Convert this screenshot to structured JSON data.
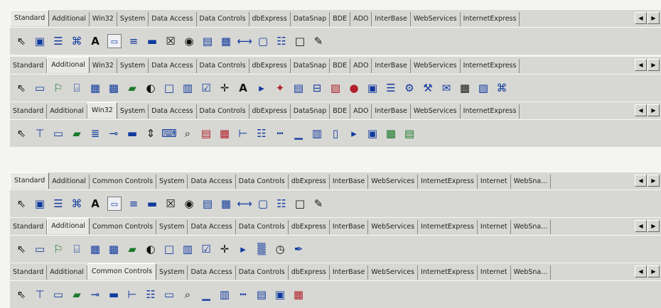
{
  "delphi_palettes": [
    {
      "tabs": [
        "Standard",
        "Additional",
        "Win32",
        "System",
        "Data Access",
        "Data Controls",
        "dbExpress",
        "DataSnap",
        "BDE",
        "ADO",
        "InterBase",
        "WebServices",
        "InternetExpress"
      ],
      "active": 0,
      "icons": [
        {
          "name": "pointer-icon",
          "glyph": "⇖",
          "cls": "dark"
        },
        {
          "name": "frame-icon",
          "glyph": "▣",
          "cls": ""
        },
        {
          "name": "mainmenu-icon",
          "glyph": "☰",
          "cls": ""
        },
        {
          "name": "popupmenu-icon",
          "glyph": "⌘",
          "cls": ""
        },
        {
          "name": "label-icon",
          "glyph": "A",
          "cls": "big"
        },
        {
          "name": "edit-icon",
          "glyph": "▭",
          "cls": "box"
        },
        {
          "name": "memo-icon",
          "glyph": "≡",
          "cls": ""
        },
        {
          "name": "button-icon",
          "glyph": "▬",
          "cls": ""
        },
        {
          "name": "checkbox-icon",
          "glyph": "☒",
          "cls": "dark"
        },
        {
          "name": "radiobutton-icon",
          "glyph": "◉",
          "cls": "dark"
        },
        {
          "name": "listbox-icon",
          "glyph": "▤",
          "cls": ""
        },
        {
          "name": "combobox-icon",
          "glyph": "▦",
          "cls": ""
        },
        {
          "name": "scrollbar-icon",
          "glyph": "⟷",
          "cls": ""
        },
        {
          "name": "groupbox-icon",
          "glyph": "▢",
          "cls": ""
        },
        {
          "name": "radiogroup-icon",
          "glyph": "☷",
          "cls": ""
        },
        {
          "name": "panel-icon",
          "glyph": "□",
          "cls": "dark"
        },
        {
          "name": "actionlist-icon",
          "glyph": "✎",
          "cls": "dark"
        }
      ]
    },
    {
      "tabs": [
        "Standard",
        "Additional",
        "Win32",
        "System",
        "Data Access",
        "Data Controls",
        "dbExpress",
        "DataSnap",
        "BDE",
        "ADO",
        "InterBase",
        "WebServices",
        "InternetExpress"
      ],
      "active": 1,
      "icons": [
        {
          "name": "pointer-icon",
          "glyph": "⇖",
          "cls": "dark"
        },
        {
          "name": "bitbtn-icon",
          "glyph": "▭",
          "cls": ""
        },
        {
          "name": "speedbutton-icon",
          "glyph": "⚐",
          "cls": "green"
        },
        {
          "name": "maskedit-icon",
          "glyph": "⌸",
          "cls": ""
        },
        {
          "name": "stringgrid-icon",
          "glyph": "▦",
          "cls": ""
        },
        {
          "name": "drawgrid-icon",
          "glyph": "▩",
          "cls": ""
        },
        {
          "name": "image-icon",
          "glyph": "▰",
          "cls": "green"
        },
        {
          "name": "shape-icon",
          "glyph": "◐",
          "cls": "dark"
        },
        {
          "name": "bevel-icon",
          "glyph": "□",
          "cls": ""
        },
        {
          "name": "scrollbox-icon",
          "glyph": "▥",
          "cls": ""
        },
        {
          "name": "checklistbox-icon",
          "glyph": "☑",
          "cls": ""
        },
        {
          "name": "splitter-icon",
          "glyph": "✛",
          "cls": "dark"
        },
        {
          "name": "statictext-icon",
          "glyph": "A",
          "cls": "big"
        },
        {
          "name": "controlbar-icon",
          "glyph": "▸",
          "cls": ""
        },
        {
          "name": "applicationevents-icon",
          "glyph": "✦",
          "cls": "red"
        },
        {
          "name": "valuelisteditor-icon",
          "glyph": "▤",
          "cls": ""
        },
        {
          "name": "labelededit-icon",
          "glyph": "⊟",
          "cls": ""
        },
        {
          "name": "colorbox-icon",
          "glyph": "▨",
          "cls": "red"
        },
        {
          "name": "chart-icon",
          "glyph": "●",
          "cls": "red"
        },
        {
          "name": "actionmanager-icon",
          "glyph": "▣",
          "cls": ""
        },
        {
          "name": "actionmainmenubar-icon",
          "glyph": "☰",
          "cls": ""
        },
        {
          "name": "actiontoolbar-icon",
          "glyph": "⚙",
          "cls": ""
        },
        {
          "name": "customizedlg-icon",
          "glyph": "⚒",
          "cls": ""
        },
        {
          "name": "xpmanifest-icon",
          "glyph": "✉",
          "cls": ""
        },
        {
          "name": "actionlist2-icon",
          "glyph": "▦",
          "cls": "dark"
        },
        {
          "name": "popupactionbar-icon",
          "glyph": "▧",
          "cls": ""
        },
        {
          "name": "colorlistbox-icon",
          "glyph": "⌘",
          "cls": ""
        }
      ]
    },
    {
      "tabs": [
        "Standard",
        "Additional",
        "Win32",
        "System",
        "Data Access",
        "Data Controls",
        "dbExpress",
        "DataSnap",
        "BDE",
        "ADO",
        "InterBase",
        "WebServices",
        "InternetExpress"
      ],
      "active": 2,
      "icons": [
        {
          "name": "pointer-icon",
          "glyph": "⇖",
          "cls": "dark"
        },
        {
          "name": "tabcontrol-icon",
          "glyph": "⊤",
          "cls": ""
        },
        {
          "name": "pagecontrol-icon",
          "glyph": "▭",
          "cls": ""
        },
        {
          "name": "imagelist-icon",
          "glyph": "▰",
          "cls": "green"
        },
        {
          "name": "richedit-icon",
          "glyph": "≣",
          "cls": ""
        },
        {
          "name": "trackbar-icon",
          "glyph": "⊸",
          "cls": ""
        },
        {
          "name": "progressbar-icon",
          "glyph": "▬",
          "cls": ""
        },
        {
          "name": "updown-icon",
          "glyph": "⇕",
          "cls": "dark"
        },
        {
          "name": "hotkey-icon",
          "glyph": "⌨",
          "cls": ""
        },
        {
          "name": "animate-icon",
          "glyph": "⌕",
          "cls": "dark"
        },
        {
          "name": "datetimepicker-icon",
          "glyph": "▤",
          "cls": "red"
        },
        {
          "name": "monthcalendar-icon",
          "glyph": "▦",
          "cls": "red"
        },
        {
          "name": "treeview-icon",
          "glyph": "⊢",
          "cls": ""
        },
        {
          "name": "listview-icon",
          "glyph": "☷",
          "cls": ""
        },
        {
          "name": "headercontrol-icon",
          "glyph": "┅",
          "cls": ""
        },
        {
          "name": "statusbar-icon",
          "glyph": "▁",
          "cls": ""
        },
        {
          "name": "toolbar-icon",
          "glyph": "▥",
          "cls": ""
        },
        {
          "name": "coolbar-icon",
          "glyph": "▯",
          "cls": ""
        },
        {
          "name": "pagescroller-icon",
          "glyph": "▸",
          "cls": ""
        },
        {
          "name": "comboboxex-icon",
          "glyph": "▣",
          "cls": ""
        },
        {
          "name": "flatscrollbar-icon",
          "glyph": "▩",
          "cls": "green"
        },
        {
          "name": "xp-icon",
          "glyph": "▤",
          "cls": "green"
        }
      ]
    },
    {
      "tabs": [
        "Standard",
        "Additional",
        "Common Controls",
        "System",
        "Data Access",
        "Data Controls",
        "dbExpress",
        "InterBase",
        "WebServices",
        "InternetExpress",
        "Internet",
        "WebSna..."
      ],
      "active": 0,
      "icons": [
        {
          "name": "pointer-icon",
          "glyph": "⇖",
          "cls": "dark"
        },
        {
          "name": "frame-icon",
          "glyph": "▣",
          "cls": ""
        },
        {
          "name": "mainmenu-icon",
          "glyph": "☰",
          "cls": ""
        },
        {
          "name": "popupmenu-icon",
          "glyph": "⌘",
          "cls": ""
        },
        {
          "name": "label-icon",
          "glyph": "A",
          "cls": "big"
        },
        {
          "name": "edit-icon",
          "glyph": "▭",
          "cls": "box"
        },
        {
          "name": "memo-icon",
          "glyph": "≡",
          "cls": ""
        },
        {
          "name": "button-icon",
          "glyph": "▬",
          "cls": ""
        },
        {
          "name": "checkbox-icon",
          "glyph": "☒",
          "cls": "dark"
        },
        {
          "name": "radiobutton-icon",
          "glyph": "◉",
          "cls": "dark"
        },
        {
          "name": "listbox-icon",
          "glyph": "▤",
          "cls": ""
        },
        {
          "name": "combobox-icon",
          "glyph": "▦",
          "cls": ""
        },
        {
          "name": "scrollbar-icon",
          "glyph": "⟷",
          "cls": ""
        },
        {
          "name": "groupbox-icon",
          "glyph": "▢",
          "cls": ""
        },
        {
          "name": "radiogroup-icon",
          "glyph": "☷",
          "cls": ""
        },
        {
          "name": "panel-icon",
          "glyph": "□",
          "cls": "dark"
        },
        {
          "name": "actionlist-icon",
          "glyph": "✎",
          "cls": "dark"
        }
      ]
    },
    {
      "tabs": [
        "Standard",
        "Additional",
        "Common Controls",
        "System",
        "Data Access",
        "Data Controls",
        "dbExpress",
        "InterBase",
        "WebServices",
        "InternetExpress",
        "Internet",
        "WebSna..."
      ],
      "active": 1,
      "icons": [
        {
          "name": "pointer-icon",
          "glyph": "⇖",
          "cls": "dark"
        },
        {
          "name": "bitbtn-icon",
          "glyph": "▭",
          "cls": ""
        },
        {
          "name": "speedbutton-icon",
          "glyph": "⚐",
          "cls": "green"
        },
        {
          "name": "maskedit-icon",
          "glyph": "⌸",
          "cls": ""
        },
        {
          "name": "stringgrid-icon",
          "glyph": "▦",
          "cls": ""
        },
        {
          "name": "drawgrid-icon",
          "glyph": "▩",
          "cls": ""
        },
        {
          "name": "image-icon",
          "glyph": "▰",
          "cls": "green"
        },
        {
          "name": "shape-icon",
          "glyph": "◐",
          "cls": "dark"
        },
        {
          "name": "bevel-icon",
          "glyph": "□",
          "cls": ""
        },
        {
          "name": "scrollbox-icon",
          "glyph": "▥",
          "cls": ""
        },
        {
          "name": "checklistbox-icon",
          "glyph": "☑",
          "cls": ""
        },
        {
          "name": "splitter-icon",
          "glyph": "✛",
          "cls": "dark"
        },
        {
          "name": "controlbar-icon",
          "glyph": "▸",
          "cls": ""
        },
        {
          "name": "lcdnumber-icon",
          "glyph": "▒",
          "cls": ""
        },
        {
          "name": "timer-icon",
          "glyph": "◷",
          "cls": "dark"
        },
        {
          "name": "pen-icon",
          "glyph": "✒",
          "cls": ""
        }
      ]
    },
    {
      "tabs": [
        "Standard",
        "Additional",
        "Common Controls",
        "System",
        "Data Access",
        "Data Controls",
        "dbExpress",
        "InterBase",
        "WebServices",
        "InternetExpress",
        "Internet",
        "WebSna..."
      ],
      "active": 2,
      "icons": [
        {
          "name": "pointer-icon",
          "glyph": "⇖",
          "cls": "dark"
        },
        {
          "name": "tabcontrol-icon",
          "glyph": "⊤",
          "cls": ""
        },
        {
          "name": "pagecontrol-icon",
          "glyph": "▭",
          "cls": ""
        },
        {
          "name": "imagelist-icon",
          "glyph": "▰",
          "cls": "green"
        },
        {
          "name": "trackbar-icon",
          "glyph": "⊸",
          "cls": ""
        },
        {
          "name": "progressbar-icon",
          "glyph": "▬",
          "cls": ""
        },
        {
          "name": "treeview-icon",
          "glyph": "⊢",
          "cls": ""
        },
        {
          "name": "listview-icon",
          "glyph": "☷",
          "cls": ""
        },
        {
          "name": "spinedit-icon",
          "glyph": "▭",
          "cls": ""
        },
        {
          "name": "animate-icon",
          "glyph": "⌕",
          "cls": "dark"
        },
        {
          "name": "statusbar-icon",
          "glyph": "▁",
          "cls": ""
        },
        {
          "name": "toolbar-icon",
          "glyph": "▥",
          "cls": ""
        },
        {
          "name": "headercontrol-icon",
          "glyph": "┅",
          "cls": ""
        },
        {
          "name": "iconview-icon",
          "glyph": "▤",
          "cls": ""
        },
        {
          "name": "textbrowser-icon",
          "glyph": "▣",
          "cls": ""
        },
        {
          "name": "textviewer-icon",
          "glyph": "▦",
          "cls": "red"
        }
      ]
    }
  ],
  "scroll_buttons": [
    "◀",
    "▶"
  ]
}
